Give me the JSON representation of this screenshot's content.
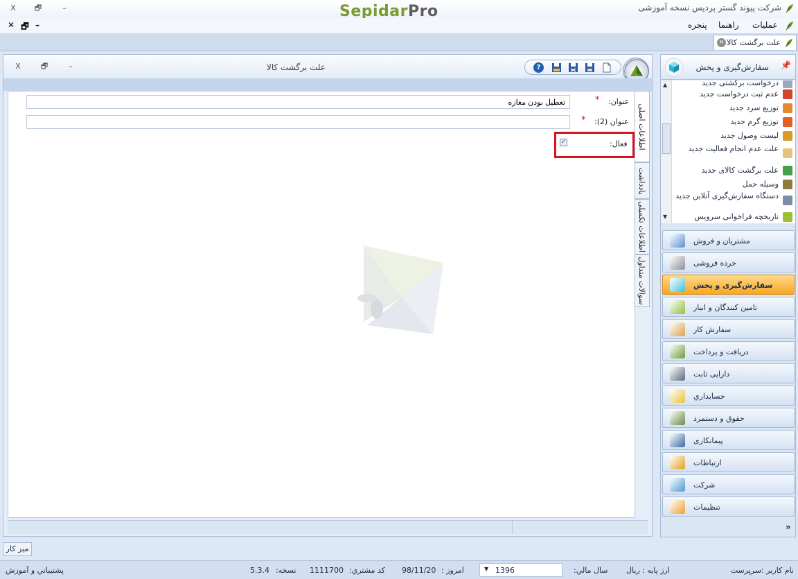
{
  "titlebar": {
    "app_title": "شرکت پیوند گستر پردیس نسخه آموزشی",
    "logo_main": "Sepidar",
    "logo_suffix": "Pro",
    "close": "X",
    "restore": "🗗",
    "minimize": "–"
  },
  "menubar": {
    "items": [
      "عملیات",
      "راهنما",
      "پنجره"
    ],
    "mdi_close": "✕",
    "mdi_restore": "🗗",
    "mdi_minimize": "–"
  },
  "doc_tab": {
    "label": "علت برگشت کالا",
    "close": "×"
  },
  "inner_window": {
    "title": "علت برگشت کالا",
    "close": "X",
    "restore": "🗗",
    "minimize": "–",
    "toolbar_help": "?"
  },
  "form": {
    "title_label": "عنوان:",
    "title_value": "تعطیل بودن مغازه",
    "title2_label": "عنوان (2):",
    "title2_value": "",
    "active_label": "فعال:",
    "required_mark": "*",
    "checkbox_mark": "✓"
  },
  "vertical_tabs": [
    "اطلاعات اصلی",
    "یادداشت",
    "اطلاعات تکمیلی",
    "سوالات متداول"
  ],
  "nav": {
    "header_title": "سفارش‌گیری و پخش",
    "pin": "📌",
    "list_items": [
      {
        "label": "درخواست برگشتی جدید",
        "color": "#9aa9bd"
      },
      {
        "label": "عدم ثبت درخواست جدید",
        "color": "#d0452f"
      },
      {
        "label": "توزیع سرد جدید",
        "color": "#e58a2c"
      },
      {
        "label": "توزیع گرم جدید",
        "color": "#e05f2a"
      },
      {
        "label": "لیست وصول جدید",
        "color": "#d99a2a"
      },
      {
        "label": "علت عدم انجام فعالیت جدید",
        "color": "#e7c27a"
      },
      {
        "label": "علت برگشت کالای جدید",
        "color": "#4aa04a"
      },
      {
        "label": "وسیله حمل",
        "color": "#8f7b3d"
      },
      {
        "label": "دستگاه سفارش‌گیری آنلاین جدید",
        "color": "#7d8ea6"
      },
      {
        "label": "تاریخچه فراخوانی سرویس",
        "color": "#9bbf3a"
      }
    ],
    "modules": [
      {
        "label": "مشتريان و فروش",
        "color": "#5b8fd6",
        "active": false
      },
      {
        "label": "خرده فروشی",
        "color": "#8a8f96",
        "active": false
      },
      {
        "label": "سفارش‌گیری و پخش",
        "color": "#3cc0d8",
        "active": true
      },
      {
        "label": "تامین کنندگان و انبار",
        "color": "#8fbf3c",
        "active": false
      },
      {
        "label": "سفارش کار",
        "color": "#d8a24a",
        "active": false
      },
      {
        "label": "دريافت و پرداخت",
        "color": "#6a9a3a",
        "active": false
      },
      {
        "label": "دارایی ثابت",
        "color": "#5a6a7a",
        "active": false
      },
      {
        "label": "حسابداري",
        "color": "#e8c23a",
        "active": false
      },
      {
        "label": "حقوق و دستمزد",
        "color": "#6a8a4a",
        "active": false
      },
      {
        "label": "پیمانکاری",
        "color": "#3a6aa8",
        "active": false
      },
      {
        "label": "ارتباطات",
        "color": "#e0a020",
        "active": false
      },
      {
        "label": "شرکت",
        "color": "#4a9ad0",
        "active": false
      },
      {
        "label": "تنظیمات",
        "color": "#f0a030",
        "active": false
      }
    ],
    "more": "»"
  },
  "desktop_tab": "ميز كار",
  "statusbar": {
    "username": "نام کاربر :سرپرست",
    "base_currency": "ارز پایه : ریال",
    "fiscal_year_label": "سال مالي:",
    "fiscal_year": "1396",
    "today_label": "امروز :",
    "today": "98/11/20",
    "customer_code_label": "کد مشتري:",
    "customer_code": "1111700",
    "version_label": "نسخه:",
    "version": "5.3.4",
    "support": "پشتیباني و آموزش"
  }
}
